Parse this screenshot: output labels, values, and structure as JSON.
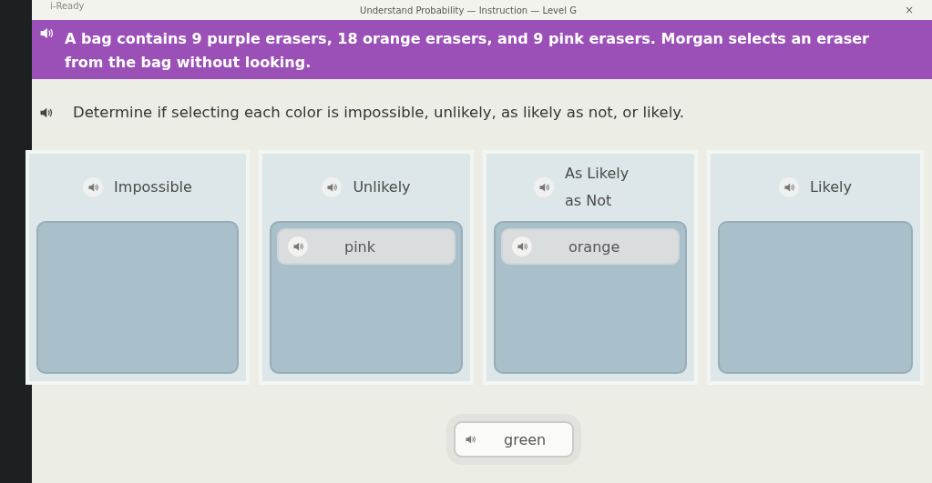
{
  "app_name": "i-Ready",
  "window": {
    "title": "Understand Probability — Instruction — Level G",
    "close": "×"
  },
  "question": "A bag contains 9 purple erasers, 18 orange erasers, and 9 pink erasers. Morgan selects an eraser from the bag without looking.",
  "instruction": "Determine if selecting each color is impossible, unlikely, as likely as not, or likely.",
  "categories": [
    {
      "label": "Impossible"
    },
    {
      "label": "Unlikely",
      "items": [
        "pink"
      ]
    },
    {
      "label": "As Likely as Not",
      "items": [
        "orange"
      ]
    },
    {
      "label": "Likely"
    }
  ],
  "answer_bank": [
    "green"
  ]
}
